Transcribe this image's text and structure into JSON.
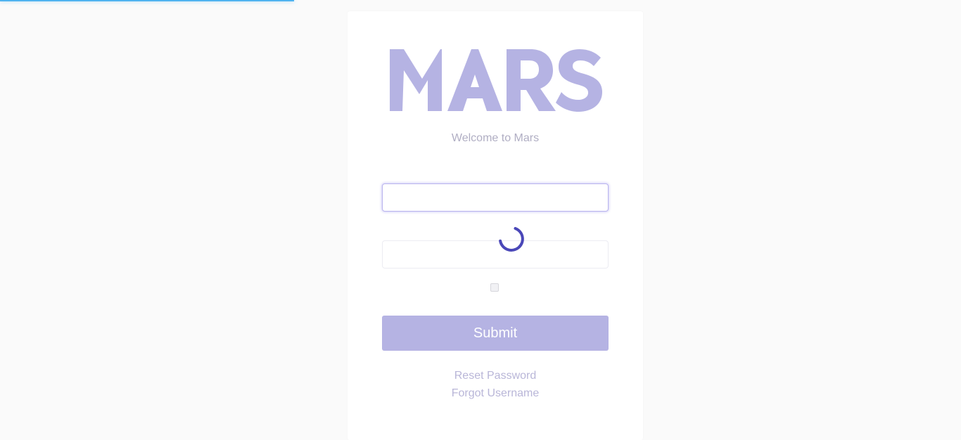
{
  "page": {
    "loading_progress": "30%"
  },
  "logo": {
    "text": "MARS",
    "color": "#b5b3e3"
  },
  "welcome": {
    "text": "Welcome to Mars"
  },
  "form": {
    "username_value": "",
    "password_value": "",
    "remember_checked": false,
    "submit_label": "Submit"
  },
  "links": {
    "reset_password": "Reset Password",
    "forgot_username": "Forgot Username"
  },
  "colors": {
    "accent": "#b5b3e3",
    "spinner": "#4a47b8",
    "progress": "#4fb3f0"
  },
  "icons": {
    "spinner": "loading-spinner-icon"
  }
}
